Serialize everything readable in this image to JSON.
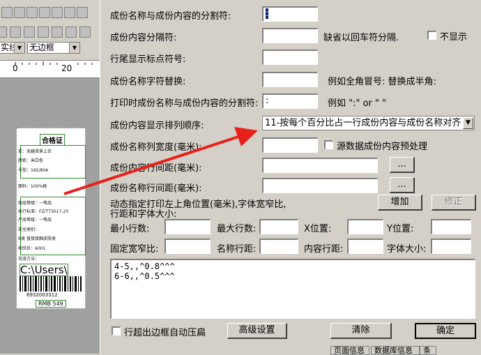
{
  "left_panel": {
    "line_style": "实线",
    "border_style": "无边框",
    "ruler_zero": "0",
    "ruler_twenty": "20",
    "label": {
      "title": "合格证",
      "lines": [
        "名：无缝背景上衣",
        "颜色：米白色",
        "号型：165/80A",
        "",
        "面料：100%棉",
        "",
        "商品等级：一等品",
        "执行标准：FZ/T73017-20",
        "产品等级：一等品",
        "安全类别：",
        "B类 直接接触皮肤类",
        "检验员：A001",
        "洗涤方法："
      ],
      "barcode_text": "C:\\Users\\",
      "barcode_number": "6932003312",
      "price": "RMB 549"
    }
  },
  "dialog": {
    "labels": {
      "separator": "成份名称与成份内容的分割符:",
      "content_sep": "成份内容分隔符:",
      "line_end": "行尾显示标点符号:",
      "name_replace": "成份名称字符替换:",
      "print_sep": "打印时成份名称与成份内容的分割符:",
      "order": "成份内容显示排列顺序:",
      "name_col_width": "成份名称列宽度(毫米):",
      "content_line_gap": "成份内容行间距(毫米):",
      "name_line_gap": "成份名称行间距(毫米):",
      "dynamic_1": "动态指定打印左上角位置(毫米),字体宽窄比,",
      "dynamic_2": "行距和字体大小:",
      "min_rows": "最小行数:",
      "max_rows": "最大行数:",
      "x_pos": "X位置:",
      "y_pos": "Y位置:",
      "fixed_ratio": "固定宽窄比:",
      "name_line_spacing": "名称行距:",
      "content_line_spacing": "内容行距:",
      "font_size": "字体大小:"
    },
    "values": {
      "separator": ":",
      "print_sep": ":"
    },
    "hints": {
      "content_sep": "缺省以回车符分隔.",
      "name_replace": "例如全角冒号: 替换成半角:",
      "print_sep": "例如  \":\" or \" \""
    },
    "checkboxes": {
      "hide": "不显示",
      "preprocess": "源数据成份内容预处理",
      "auto_compress": "行超出边框自动压扁"
    },
    "order_select": "11-按每个百分比占一行成份内容与成份名称对齐",
    "buttons": {
      "dots1": "...",
      "dots2": "...",
      "add": "增加",
      "modify": "修正",
      "advanced": "高级设置",
      "clear": "清除",
      "ok": "确定"
    },
    "textarea_text": "4-5,,^0.8^^^\n6-6,,^0.5^^^"
  },
  "bottom_tabs": [
    "页面信息",
    "数据库信息",
    "条"
  ],
  "colors": {
    "arrow": "#e8201a",
    "dialog_bg": "#d4d0c8"
  }
}
